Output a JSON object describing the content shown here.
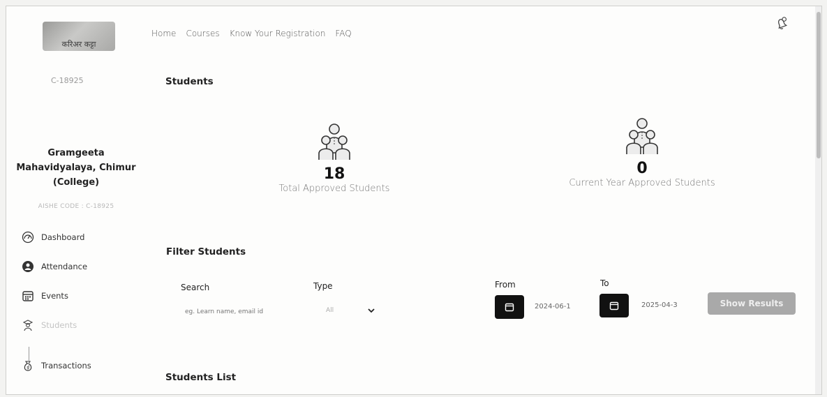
{
  "logo": {
    "text": "करिअर कट्टा"
  },
  "nav": {
    "items": [
      "Home",
      "Courses",
      "Know Your Registration",
      "FAQ"
    ]
  },
  "sidebar": {
    "code_top": "C-18925",
    "college_line1": "Gramgeeta",
    "college_line2": "Mahavidyalaya, Chimur",
    "college_line3": "(College)",
    "aishe_code": "AISHE CODE : C-18925",
    "menu": [
      {
        "label": "Dashboard",
        "icon": "dashboard-icon"
      },
      {
        "label": "Attendance",
        "icon": "attendance-icon"
      },
      {
        "label": "Events",
        "icon": "calendar-icon"
      },
      {
        "label": "Students",
        "icon": "students-icon"
      },
      {
        "label": "Transactions",
        "icon": "money-bag-icon"
      }
    ]
  },
  "main": {
    "students_heading": "Students",
    "stats": [
      {
        "value": "18",
        "label": "Total Approved Students"
      },
      {
        "value": "0",
        "label": "Current Year Approved Students"
      }
    ],
    "filter_heading": "Filter Students",
    "filter": {
      "search_label": "Search",
      "search_placeholder": "eg. Learn name, email id",
      "type_label": "Type",
      "type_value": "All",
      "from_label": "From",
      "from_value": "2024-06-1",
      "to_label": "To",
      "to_value": "2025-04-3",
      "show_button": "Show Results"
    },
    "list_heading": "Students List"
  }
}
